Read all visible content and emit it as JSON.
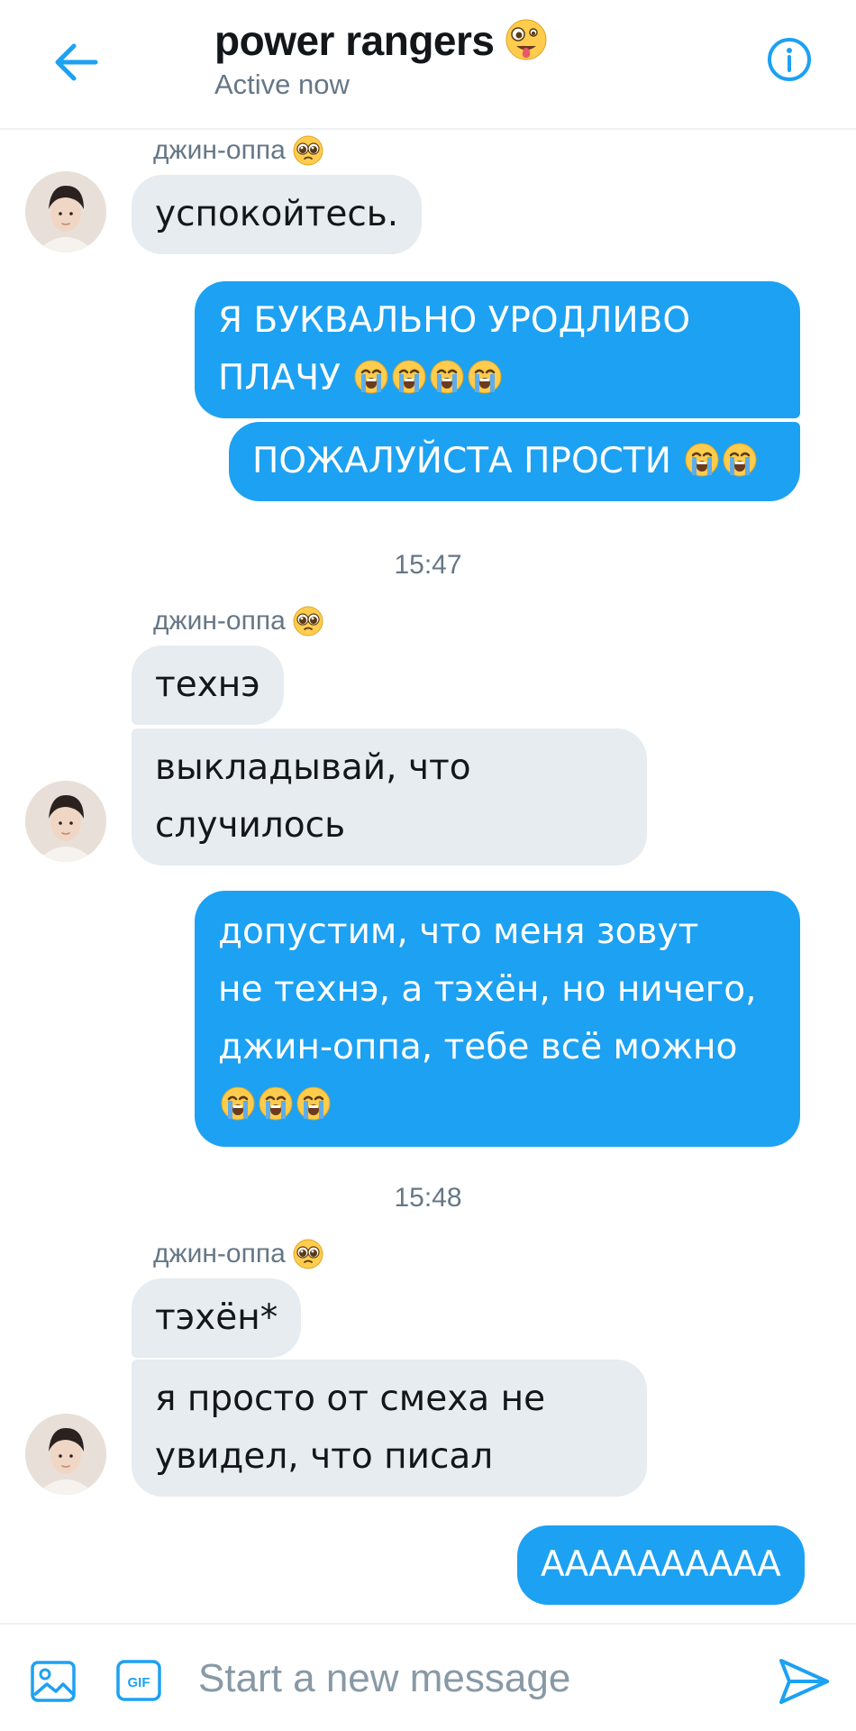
{
  "header": {
    "back_icon": "arrow-left-icon",
    "title": "power rangers",
    "title_emoji": "🤪",
    "status": "Active now",
    "info_icon": "info-icon"
  },
  "colors": {
    "accent": "#1da1f2",
    "incoming_bubble": "#e6ecf0",
    "muted_text": "#657786"
  },
  "messages": {
    "sender_name": "джин-оппа",
    "g1_m1": "успокойтесь.",
    "o1_m1": "Я БУКВАЛЬНО УРОДЛИВО ПЛАЧУ",
    "o1_m2": "ПОЖАЛУЙСТА ПРОСТИ",
    "time1": "15:47",
    "g2_m1": "технэ",
    "g2_m2_l1": "выкладывай, что",
    "g2_m2_l2": "случилось",
    "o2_l1": "допустим, что меня зовут",
    "o2_l2": "не технэ, а тэхён, но ничего,",
    "o2_l3": "джин-оппа, тебе всё можно",
    "time2": "15:48",
    "g3_m1": "тэхён*",
    "g3_m2_l1": "я просто от смеха не",
    "g3_m2_l2": "увидел, что писал",
    "o3_m1": "АААААААААА"
  },
  "composer": {
    "image_icon": "image-icon",
    "gif_label": "GIF",
    "placeholder": "Start a new message",
    "value": "",
    "send_icon": "send-icon"
  }
}
